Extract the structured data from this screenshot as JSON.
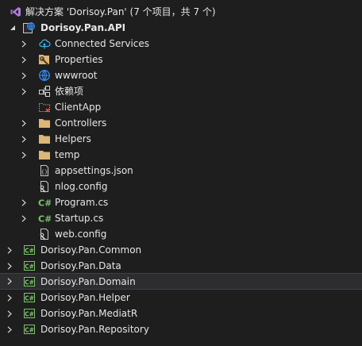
{
  "solution": {
    "label": "解决方案 'Dorisoy.Pan' (7 个项目，共 7 个)",
    "icon": "solution-icon"
  },
  "api_project": {
    "label": "Dorisoy.Pan.API",
    "icon": "web-project-icon",
    "children": [
      {
        "label": "Connected Services",
        "icon": "connected-services-icon"
      },
      {
        "label": "Properties",
        "icon": "properties-wrench-icon"
      },
      {
        "label": "wwwroot",
        "icon": "globe-icon"
      },
      {
        "label": "依赖项",
        "icon": "dependencies-icon"
      },
      {
        "label": "ClientApp",
        "icon": "missing-folder-icon"
      },
      {
        "label": "Controllers",
        "icon": "folder-icon"
      },
      {
        "label": "Helpers",
        "icon": "folder-icon"
      },
      {
        "label": "temp",
        "icon": "folder-icon"
      },
      {
        "label": "appsettings.json",
        "icon": "json-file-icon"
      },
      {
        "label": "nlog.config",
        "icon": "config-file-icon"
      },
      {
        "label": "Program.cs",
        "icon": "csharp-file-icon"
      },
      {
        "label": "Startup.cs",
        "icon": "csharp-file-icon"
      },
      {
        "label": "web.config",
        "icon": "config-file-icon"
      }
    ]
  },
  "projects": [
    {
      "label": "Dorisoy.Pan.Common",
      "icon": "csharp-project-icon"
    },
    {
      "label": "Dorisoy.Pan.Data",
      "icon": "csharp-project-icon"
    },
    {
      "label": "Dorisoy.Pan.Domain",
      "icon": "csharp-project-icon"
    },
    {
      "label": "Dorisoy.Pan.Helper",
      "icon": "csharp-project-icon"
    },
    {
      "label": "Dorisoy.Pan.MediatR",
      "icon": "csharp-project-icon"
    },
    {
      "label": "Dorisoy.Pan.Repository",
      "icon": "csharp-project-icon"
    }
  ],
  "colors": {
    "background": "#1e1e1e",
    "text": "#e6e6e6",
    "folder": "#dcb67a",
    "csharp": "#7cc46b",
    "selection": "#2d2d30",
    "accent": "#3794ff"
  }
}
